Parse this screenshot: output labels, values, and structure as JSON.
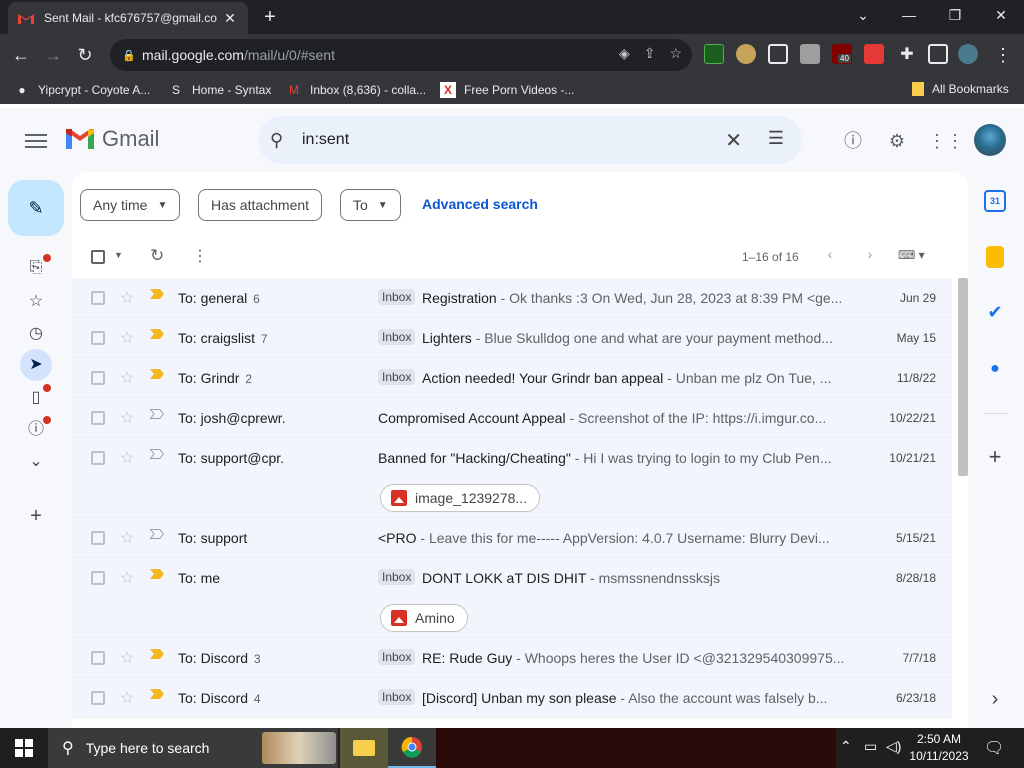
{
  "browser": {
    "tab_title": "Sent Mail - kfc676757@gmail.co",
    "url_host": "mail.google.com",
    "url_path": "/mail/u/0/#sent",
    "ublock_count": "40",
    "bookmarks": [
      {
        "label": "Yipcrypt - Coyote A..."
      },
      {
        "label": "Home - Syntax"
      },
      {
        "label": "Inbox (8,636) - colla..."
      },
      {
        "label": "Free Porn Videos -..."
      }
    ],
    "all_bookmarks": "All Bookmarks"
  },
  "gmail": {
    "logo": "Gmail",
    "search_value": "in:sent",
    "filters": {
      "any_time": "Any time",
      "has_attachment": "Has attachment",
      "to": "To",
      "advanced": "Advanced search"
    },
    "page_info": "1–16 of 16",
    "emails": [
      {
        "to": "To: general",
        "count": "6",
        "label": "Inbox",
        "subject": "Registration",
        "preview": " - Ok thanks :3 On Wed, Jun 28, 2023 at 8:39 PM <ge...",
        "date": "Jun 29",
        "important": true
      },
      {
        "to": "To: craigslist",
        "count": "7",
        "label": "Inbox",
        "subject": "Lighters",
        "preview": " - Blue Skulldog one and what are your payment method...",
        "date": "May 15",
        "important": true
      },
      {
        "to": "To: Grindr",
        "count": "2",
        "label": "Inbox",
        "subject": "Action needed! Your Grindr ban appeal",
        "preview": " - Unban me plz On Tue, ...",
        "date": "11/8/22",
        "important": true
      },
      {
        "to": "To: josh@cprewr.",
        "count": "",
        "label": "",
        "subject": "Compromised Account Appeal",
        "preview": " - Screenshot of the IP: https://i.imgur.co...",
        "date": "10/22/21",
        "important": false
      },
      {
        "to": "To: support@cpr.",
        "count": "",
        "label": "",
        "subject": "Banned for \"Hacking/Cheating\"",
        "preview": " - Hi I was trying to login to my Club Pen...",
        "date": "10/21/21",
        "important": false,
        "attachment": "image_1239278..."
      },
      {
        "to": "To: support",
        "count": "",
        "label": "",
        "subject": "<PRO",
        "preview": " - Leave this for me----- AppVersion: 4.0.7 Username: Blurry Devi...",
        "date": "5/15/21",
        "important": false
      },
      {
        "to": "To: me",
        "count": "",
        "label": "Inbox",
        "subject": "DONT LOKK aT DIS DHIT",
        "preview": " - msmssnendnssksjs",
        "date": "8/28/18",
        "important": true,
        "attachment": "Amino"
      },
      {
        "to": "To: Discord",
        "count": "3",
        "label": "Inbox",
        "subject": "RE: Rude Guy",
        "preview": " - Whoops heres the User ID <@321329540309975...",
        "date": "7/7/18",
        "important": true
      },
      {
        "to": "To: Discord",
        "count": "4",
        "label": "Inbox",
        "subject": "[Discord] Unban my son please",
        "preview": " - Also the account was falsely b...",
        "date": "6/23/18",
        "important": true
      }
    ]
  },
  "taskbar": {
    "search_placeholder": "Type here to search",
    "time": "2:50 AM",
    "date": "10/11/2023"
  },
  "colors": {
    "important_marker": "#f2b822",
    "compose_bg": "#c2e7ff",
    "link_blue": "#0b57d0"
  }
}
